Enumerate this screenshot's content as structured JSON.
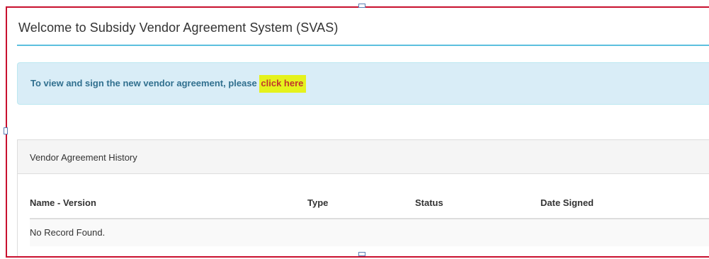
{
  "header": {
    "title": "Welcome to Subsidy Vendor Agreement System (SVAS)"
  },
  "alert": {
    "message": "To view and sign the new vendor agreement, please ",
    "link_label": "click here"
  },
  "history_panel": {
    "title": "Vendor Agreement History",
    "columns": [
      "Name - Version",
      "Type",
      "Status",
      "Date Signed"
    ],
    "empty_message": "No Record Found."
  },
  "colors": {
    "frame_border": "#c8102e",
    "title_rule": "#5bc0de",
    "alert_bg": "#d9edf7",
    "alert_text": "#31708f",
    "link_highlight": "#e5f21c",
    "link_text": "#c0392b"
  }
}
